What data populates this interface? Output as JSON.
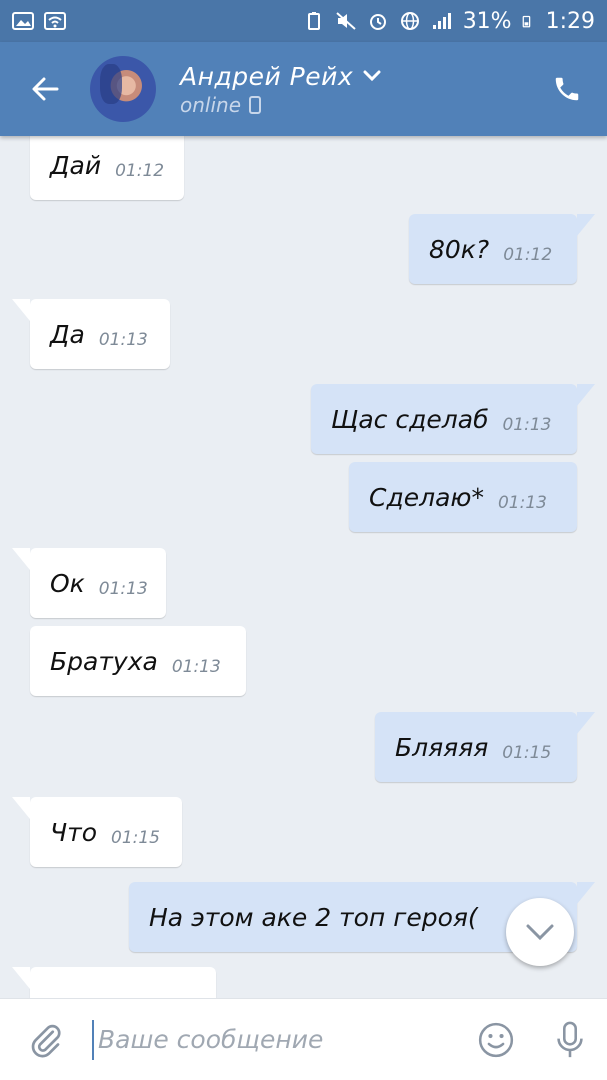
{
  "status_bar": {
    "battery_pct": "31%",
    "time": "1:29"
  },
  "header": {
    "back_icon": "arrow-left-icon",
    "contact_name": "Андрей Рейх",
    "contact_status": "online",
    "call_icon": "phone-icon"
  },
  "messages": [
    {
      "dir": "in",
      "text": "Дай",
      "time": "01:12",
      "tail": false
    },
    {
      "dir": "out",
      "text": "80к?",
      "time": "01:12",
      "tail": true
    },
    {
      "dir": "in",
      "text": "Да",
      "time": "01:13",
      "tail": true
    },
    {
      "dir": "out",
      "text": "Щас сделаб",
      "time": "01:13",
      "tail": true
    },
    {
      "dir": "out",
      "text": "Сделаю*",
      "time": "01:13",
      "tail": false
    },
    {
      "dir": "in",
      "text": "Ок",
      "time": "01:13",
      "tail": true
    },
    {
      "dir": "in",
      "text": "Братуха",
      "time": "01:13",
      "tail": false
    },
    {
      "dir": "out",
      "text": "Бляяяя",
      "time": "01:15",
      "tail": true
    },
    {
      "dir": "in",
      "text": "Что",
      "time": "01:15",
      "tail": true
    },
    {
      "dir": "out",
      "text": "На этом аке 2 топ героя(",
      "time": "",
      "tail": true
    },
    {
      "dir": "in",
      "text": "",
      "time": "",
      "tail": true
    }
  ],
  "input": {
    "placeholder": "Ваше сообщение"
  },
  "colors": {
    "header": "#5181b8",
    "status_bar": "#4a76a8",
    "background": "#eaeef3",
    "incoming_bubble": "#ffffff",
    "outgoing_bubble": "#d5e3f7"
  }
}
